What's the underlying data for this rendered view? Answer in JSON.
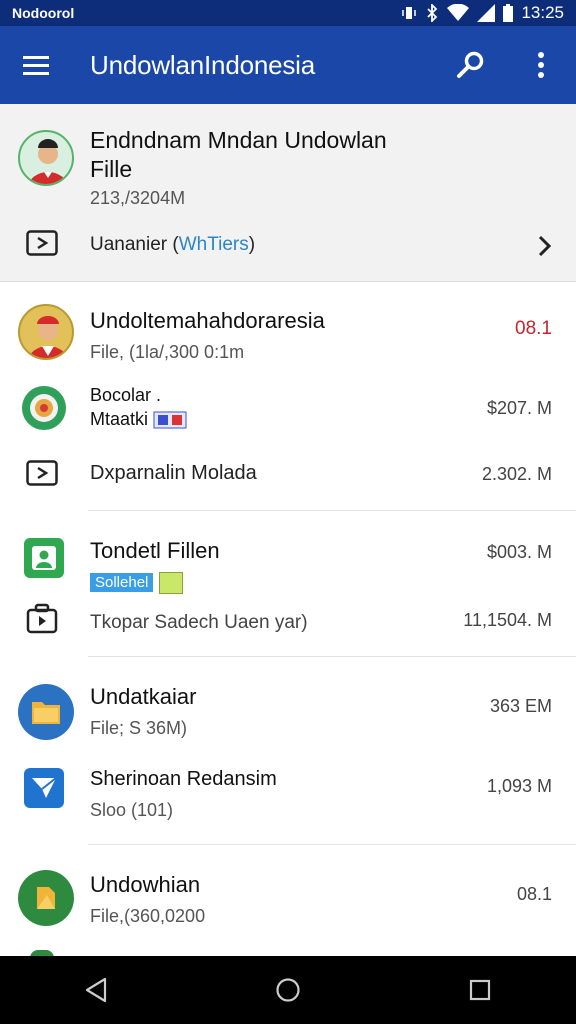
{
  "status_bar": {
    "carrier": "Nodoorol",
    "time": "13:25"
  },
  "app_bar": {
    "title": "UndowlanIndonesia"
  },
  "header": {
    "title": "Endndnam Mndan Undowlan Fille",
    "subtitle": "213,/3204M",
    "link_prefix": "Uananier (",
    "link_text": "WhTiers",
    "link_suffix": ")"
  },
  "items": [
    {
      "title": "Undoltemahahdoraresia",
      "subtitle": "File, (1la/,300 0:1m",
      "value": "08.1",
      "value_color": "#c0262d"
    },
    {
      "title": "Bocolar .",
      "subtitle": "Mtaatki",
      "value": "$207. M"
    },
    {
      "title": "Dxparnalin Molada",
      "value": "2.302. M"
    },
    {
      "title": "Tondetl Fillen",
      "tag": "Sollehel",
      "value": "$003. M"
    },
    {
      "title": "Tkopar Sadech Uaen yar)",
      "value": "11,1504. M"
    },
    {
      "title": "Undatkaiar",
      "subtitle": "File; S 36M)",
      "value": "363 EM"
    },
    {
      "title": "Sherinoan Redansim",
      "subtitle": "Sloo (101)",
      "value": "1,093 M"
    },
    {
      "title": "Undowhian",
      "subtitle": "File,(360,0200",
      "value": "08.1"
    }
  ],
  "colors": {
    "status_bar": "#0d2d7a",
    "app_bar": "#1a47a8",
    "accent_red": "#c0262d",
    "link": "#2a86c8"
  },
  "icons": [
    "menu-icon",
    "search-icon",
    "more-vert-icon",
    "bluetooth-icon",
    "wifi-icon",
    "signal-icon",
    "battery-icon",
    "back-icon",
    "home-icon",
    "recents-icon"
  ]
}
